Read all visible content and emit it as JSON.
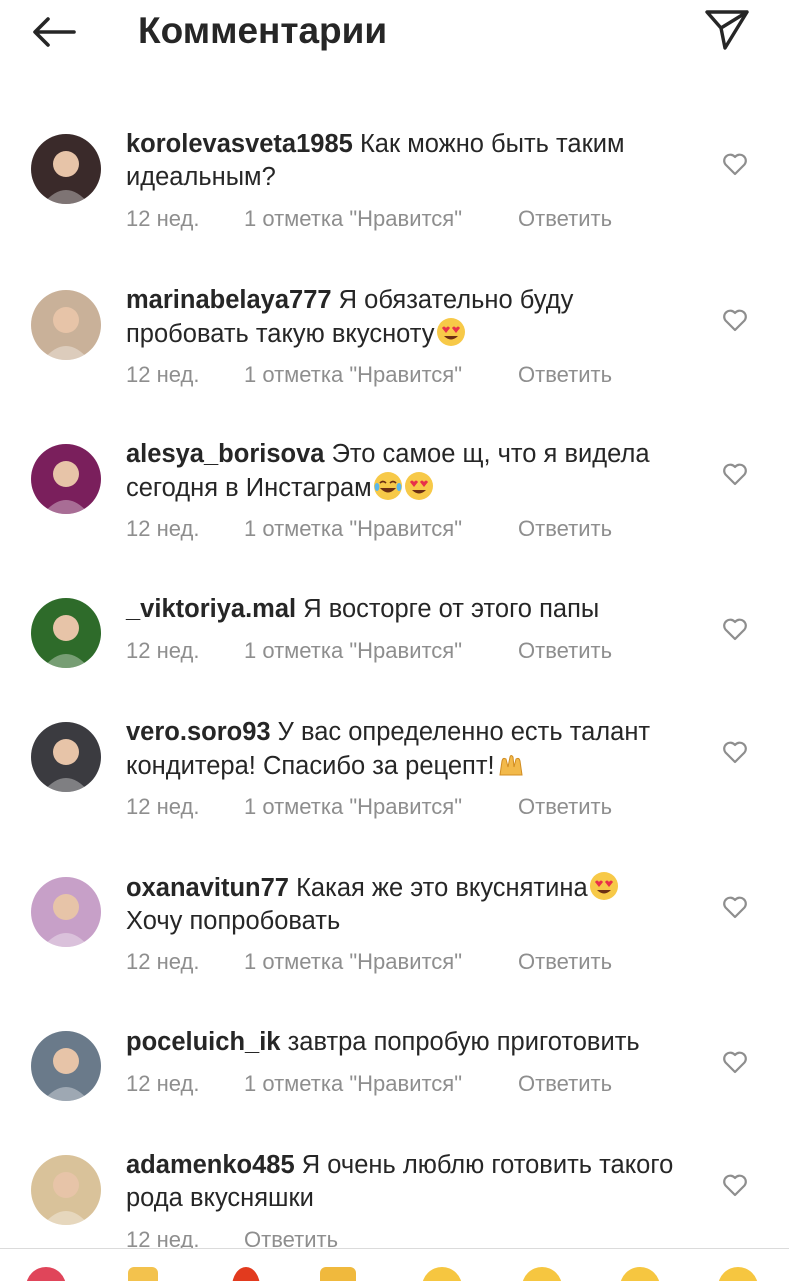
{
  "header": {
    "title": "Комментарии",
    "back_icon": "arrow-left-icon",
    "send_icon": "paper-plane-icon"
  },
  "comments": [
    {
      "username": "korolevasveta1985",
      "text": "Как можно быть таким идеальным?",
      "emojis": [],
      "time": "12 нед.",
      "likes": "1 отметка \"Нравится\"",
      "reply": "Ответить",
      "avatar_color": "#3a2a2a"
    },
    {
      "username": "marinabelaya777",
      "text": "Я обязательно буду пробовать такую вкусноту",
      "emojis": [
        "heart-eyes"
      ],
      "time": "12 нед.",
      "likes": "1 отметка \"Нравится\"",
      "reply": "Ответить",
      "avatar_color": "#c9b199"
    },
    {
      "username": "alesya_borisova",
      "text": "Это самое щ, что я видела сегодня в Инстаграм",
      "emojis": [
        "tears-of-joy",
        "heart-eyes"
      ],
      "time": "12 нед.",
      "likes": "1 отметка \"Нравится\"",
      "reply": "Ответить",
      "avatar_color": "#7a1f5c"
    },
    {
      "username": "_viktoriya.mal",
      "text": "Я восторге от этого папы",
      "emojis": [],
      "time": "12 нед.",
      "likes": "1 отметка \"Нравится\"",
      "reply": "Ответить",
      "avatar_color": "#2e6b2a"
    },
    {
      "username": "vero.soro93",
      "text": "У вас определенно есть талант кондитера! Спасибо за рецепт!",
      "emojis": [
        "raising-hands"
      ],
      "time": "12 нед.",
      "likes": "1 отметка \"Нравится\"",
      "reply": "Ответить",
      "avatar_color": "#3b3b40"
    },
    {
      "username": "oxanavitun77",
      "text": "Какая же это вкуснятина",
      "text2": "Хочу попробовать",
      "emojis": [
        "heart-eyes"
      ],
      "time": "12 нед.",
      "likes": "1 отметка \"Нравится\"",
      "reply": "Ответить",
      "avatar_color": "#c7a0c8"
    },
    {
      "username": "poceluich_ik",
      "text": "завтра попробую приготовить",
      "emojis": [],
      "time": "12 нед.",
      "likes": "1 отметка \"Нравится\"",
      "reply": "Ответить",
      "avatar_color": "#6a7a8a"
    },
    {
      "username": "adamenko485",
      "text": "Я очень люблю готовить такого рода вкусняшки",
      "emojis": [],
      "time": "12 нед.",
      "likes": "",
      "reply": "Ответить",
      "avatar_color": "#d9c29a"
    }
  ],
  "quick_reactions": [
    "heart-reaction",
    "raising-hands-reaction",
    "fire-reaction",
    "clap-reaction",
    "crying-reaction",
    "heart-eyes-reaction",
    "surprised-reaction",
    "laughing-reaction"
  ],
  "colors": {
    "text": "#262626",
    "secondary": "#8e8e8e",
    "divider": "#dbdbdb"
  }
}
